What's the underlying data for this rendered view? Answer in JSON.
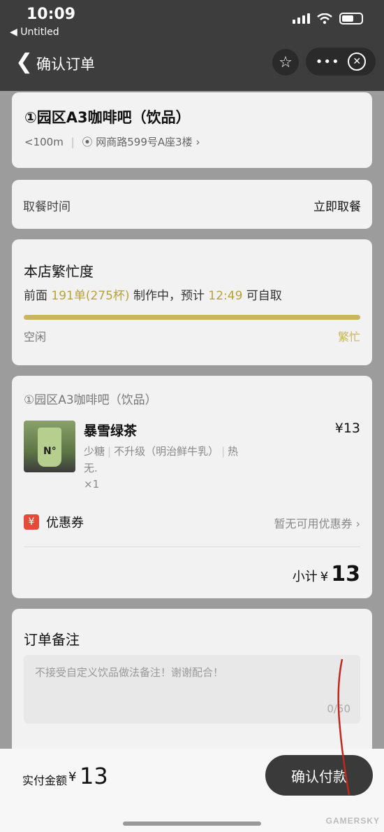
{
  "status_bar": {
    "time": "10:09",
    "back_app": "◀ Untitled"
  },
  "nav": {
    "title": "确认订单"
  },
  "store": {
    "name": "①园区A3咖啡吧（饮品）",
    "distance": "<100m",
    "address": "网商路599号A座3楼"
  },
  "pickup": {
    "label": "取餐时间",
    "value": "立即取餐"
  },
  "busyness": {
    "title": "本店繁忙度",
    "prefix": "前面",
    "queue": "191单(275杯)",
    "middle": "制作中，预计",
    "eta": "12:49",
    "suffix": "可自取",
    "level": 1.0,
    "low_label": "空闲",
    "high_label": "繁忙"
  },
  "order": {
    "store_name": "①园区A3咖啡吧（饮品）",
    "item": {
      "name": "暴雪绿茶",
      "price": "¥13",
      "options": [
        "少糖",
        "不升级（明治鲜牛乳）",
        "热"
      ],
      "extra": "无.",
      "quantity": "×1"
    },
    "coupon": {
      "icon": "¥",
      "label": "优惠券",
      "value": "暂无可用优惠券"
    },
    "subtotal": {
      "label": "小计",
      "currency": "¥",
      "amount": "13"
    }
  },
  "note": {
    "title": "订单备注",
    "placeholder": "不接受自定义饮品做法备注！谢谢配合！",
    "counter": "0/50"
  },
  "footer": {
    "pay_label": "实付金额",
    "pay_currency": "¥",
    "pay_amount": "13",
    "confirm_label": "确认付款",
    "watermark": "GAMERSKY"
  }
}
